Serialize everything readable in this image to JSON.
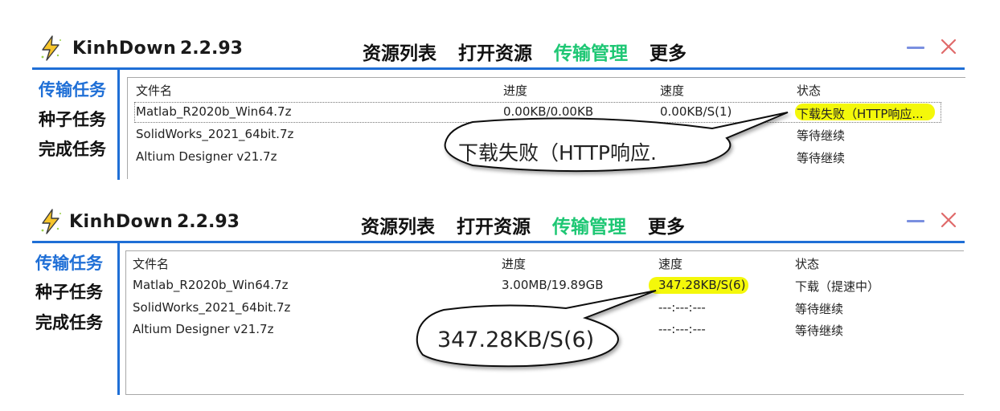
{
  "panels": [
    {
      "app": {
        "name": "KinhDown",
        "version": "2.2.93"
      },
      "nav": [
        "资源列表",
        "打开资源",
        "传输管理",
        "更多"
      ],
      "sidebar": [
        "传输任务",
        "种子任务",
        "完成任务"
      ],
      "columns": [
        "文件名",
        "进度",
        "速度",
        "状态"
      ],
      "rows": [
        {
          "name": "Matlab_R2020b_Win64.7z",
          "progress": "0.00KB/0.00KB",
          "speed": "0.00KB/S(1)",
          "status": "下载失败（HTTP响应..."
        },
        {
          "name": "SolidWorks_2021_64bit.7z",
          "progress": "",
          "speed": "",
          "status": "等待继续"
        },
        {
          "name": "Altium Designer v21.7z",
          "progress": "",
          "speed": "",
          "status": "等待继续"
        }
      ],
      "callout": "下载失败（HTTP响应."
    },
    {
      "app": {
        "name": "KinhDown",
        "version": "2.2.93"
      },
      "nav": [
        "资源列表",
        "打开资源",
        "传输管理",
        "更多"
      ],
      "sidebar": [
        "传输任务",
        "种子任务",
        "完成任务"
      ],
      "columns": [
        "文件名",
        "进度",
        "速度",
        "状态"
      ],
      "rows": [
        {
          "name": "Matlab_R2020b_Win64.7z",
          "progress": "3.00MB/19.89GB",
          "speed": "347.28KB/S(6)",
          "status": "下载（提速中）"
        },
        {
          "name": "SolidWorks_2021_64bit.7z",
          "progress": "---:---:---",
          "speed": "---:---:---",
          "status": "等待继续"
        },
        {
          "name": "Altium Designer v21.7z",
          "progress": "---:---:---",
          "speed": "---:---:---",
          "status": "等待继续"
        }
      ],
      "callout": "347.28KB/S(6)"
    }
  ],
  "colors": {
    "accent_blue": "#1f6fd6",
    "active_green": "#1ec774",
    "highlight_yellow": "#f4f80a",
    "close_red": "#e06a6a",
    "minimize_blue": "#7a8fe0"
  },
  "icons": [
    "lightning-logo-icon",
    "minimize-icon",
    "close-icon"
  ]
}
